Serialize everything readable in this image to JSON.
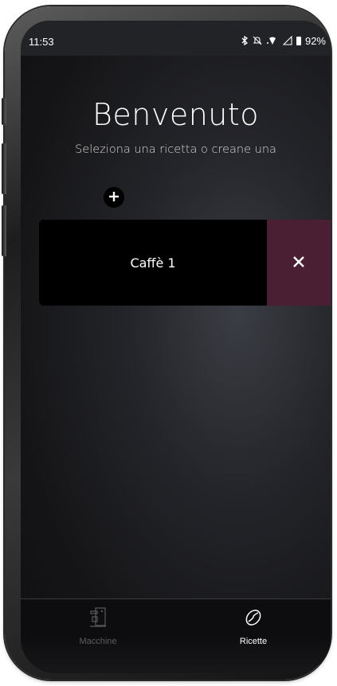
{
  "status_bar": {
    "time": "11:53",
    "icons": [
      "bluetooth-icon",
      "notifications-off-icon",
      "wifi-icon",
      "signal-icon",
      "battery-icon"
    ],
    "battery_percent": "92%"
  },
  "header": {
    "title": "Benvenuto",
    "subtitle": "Seleziona una ricetta o creane una"
  },
  "actions": {
    "add_icon": "plus-icon"
  },
  "recipes": [
    {
      "name": "Caffè 1",
      "delete_icon": "close-icon",
      "delete_color": "#4a1f33"
    }
  ],
  "bottom_nav": {
    "items": [
      {
        "label": "Macchine",
        "icon": "coffee-machine-icon",
        "active": false
      },
      {
        "label": "Ricette",
        "icon": "coffee-bean-icon",
        "active": true
      }
    ]
  },
  "colors": {
    "background": "#1c1d21",
    "card": "#000000",
    "delete_accent": "#4a1f33",
    "nav_inactive": "#5a5a5e",
    "nav_active": "#ffffff"
  }
}
